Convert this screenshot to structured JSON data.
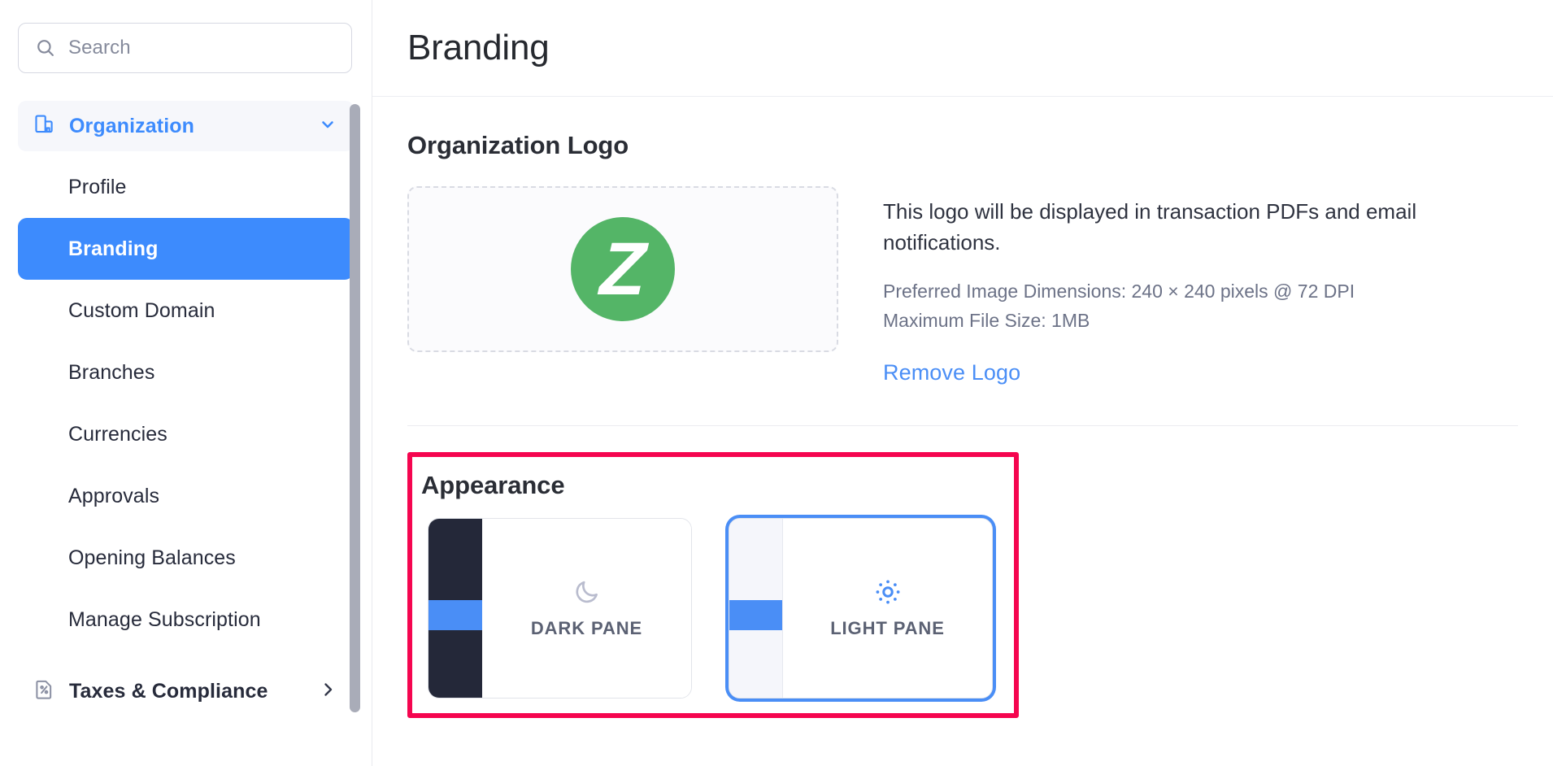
{
  "search": {
    "placeholder": "Search",
    "value": "",
    "icon": "search-icon"
  },
  "sidebar": {
    "group": {
      "label": "Organization",
      "icon": "organization-icon",
      "chevron": "chevron-down-icon",
      "expanded": true
    },
    "items": [
      {
        "label": "Profile",
        "active": false
      },
      {
        "label": "Branding",
        "active": true
      },
      {
        "label": "Custom Domain",
        "active": false
      },
      {
        "label": "Branches",
        "active": false
      },
      {
        "label": "Currencies",
        "active": false
      },
      {
        "label": "Approvals",
        "active": false
      },
      {
        "label": "Opening Balances",
        "active": false
      },
      {
        "label": "Manage Subscription",
        "active": false
      }
    ],
    "sections": [
      {
        "label": "Taxes & Compliance",
        "icon": "tax-document-icon",
        "chevron": "chevron-right-icon"
      }
    ],
    "scrollbar": {
      "visible": true
    }
  },
  "header": {
    "title": "Branding"
  },
  "logo_section": {
    "title": "Organization Logo",
    "logo": {
      "letter": "Z",
      "background_color": "#54b567",
      "text_color": "#ffffff"
    },
    "description": "This logo will be displayed in transaction PDFs and email notifications.",
    "preferred_dimensions": "Preferred Image Dimensions: 240 × 240 pixels @ 72 DPI",
    "max_file_size": "Maximum File Size: 1MB",
    "remove_label": "Remove Logo"
  },
  "appearance": {
    "title": "Appearance",
    "highlight_color": "#f5054f",
    "accent_color": "#4a8ef6",
    "options": [
      {
        "label": "DARK PANE",
        "icon": "moon-icon",
        "selected": false,
        "rail_color": "#242839"
      },
      {
        "label": "LIGHT PANE",
        "icon": "sun-icon",
        "selected": true,
        "rail_color": "#f5f6fb"
      }
    ]
  }
}
